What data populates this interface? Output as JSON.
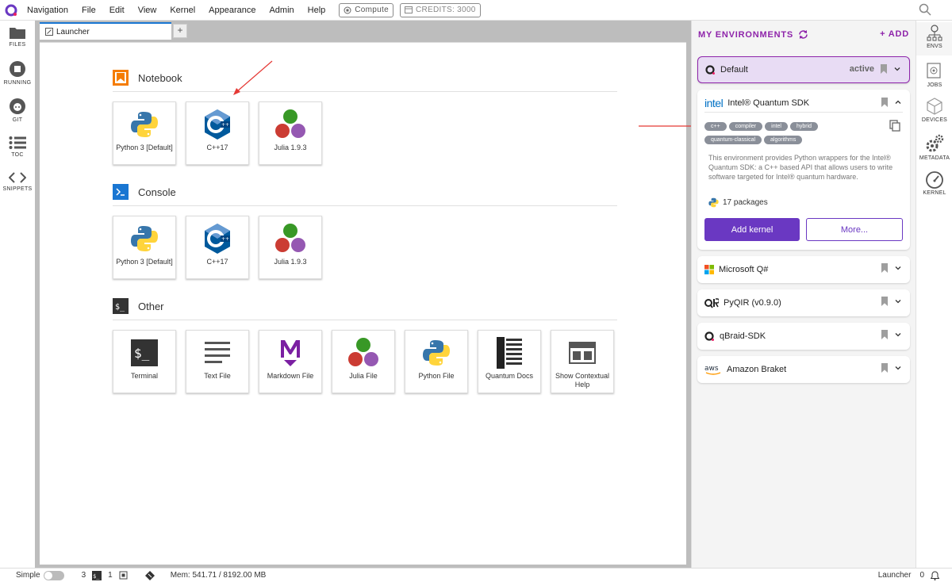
{
  "menubar": {
    "items": [
      "Navigation",
      "File",
      "Edit",
      "View",
      "Kernel",
      "Appearance",
      "Admin",
      "Help"
    ],
    "compute_label": "Compute",
    "credits_label": "CREDITS: 3000"
  },
  "leftbar": {
    "items": [
      "FILES",
      "RUNNING",
      "GIT",
      "TOC",
      "SNIPPETS"
    ]
  },
  "tabs": {
    "launcher_label": "Launcher",
    "add_label": "+"
  },
  "launcher": {
    "notebook": {
      "title": "Notebook",
      "cards": [
        {
          "label": "Python 3 [Default]",
          "icon": "python-icon"
        },
        {
          "label": "C++17",
          "icon": "cpp-icon"
        },
        {
          "label": "Julia 1.9.3",
          "icon": "julia-icon"
        }
      ]
    },
    "console": {
      "title": "Console",
      "cards": [
        {
          "label": "Python 3 [Default]",
          "icon": "python-icon"
        },
        {
          "label": "C++17",
          "icon": "cpp-icon"
        },
        {
          "label": "Julia 1.9.3",
          "icon": "julia-icon"
        }
      ]
    },
    "other": {
      "title": "Other",
      "cards": [
        {
          "label": "Terminal",
          "icon": "terminal-icon"
        },
        {
          "label": "Text File",
          "icon": "text-file-icon"
        },
        {
          "label": "Markdown File",
          "icon": "markdown-icon"
        },
        {
          "label": "Julia File",
          "icon": "julia-icon"
        },
        {
          "label": "Python File",
          "icon": "python-icon"
        },
        {
          "label": "Quantum Docs",
          "icon": "docs-icon"
        },
        {
          "label": "Show Contextual Help",
          "icon": "help-icon"
        }
      ]
    }
  },
  "envpanel": {
    "title": "MY ENVIRONMENTS",
    "add_label": "+ ADD",
    "default": {
      "name": "Default",
      "status": "active"
    },
    "intel": {
      "logo_text": "intel",
      "name": "Intel® Quantum SDK",
      "tags": [
        "c++",
        "compiler",
        "intel",
        "hybrid",
        "quantum-classical",
        "algorithms"
      ],
      "description": "This environment provides Python wrappers for the Intel® Quantum SDK: a C++ based API that allows users to write software targeted for Intel® quantum hardware.",
      "packages": "17 packages",
      "add_kernel": "Add kernel",
      "more": "More..."
    },
    "others": [
      {
        "name": "Microsoft Q#",
        "icon": "microsoft-icon"
      },
      {
        "name": "PyQIR (v0.9.0)",
        "icon": "pyqir-icon"
      },
      {
        "name": "qBraid-SDK",
        "icon": "qbraid-icon"
      },
      {
        "name": "Amazon Braket",
        "icon": "aws-icon"
      }
    ]
  },
  "rightbar": {
    "items": [
      "ENVS",
      "JOBS",
      "DEVICES",
      "METADATA",
      "KERNEL"
    ]
  },
  "status": {
    "mode_label": "Simple",
    "terminals_count": "3",
    "kernels_count": "1",
    "memory": "Mem: 541.71 / 8192.00 MB",
    "current_tab": "Launcher",
    "notifications": "0"
  },
  "colors": {
    "accent": "#8e24aa",
    "button": "#6a38c2",
    "tab_active": "#1976d2"
  }
}
